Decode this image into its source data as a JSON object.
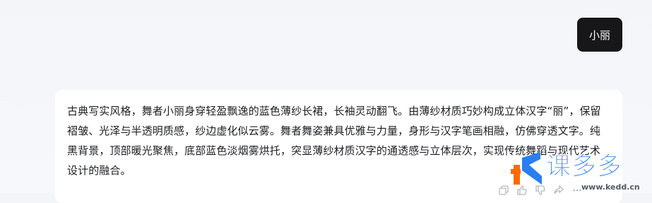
{
  "conversation": {
    "user_message": "小丽",
    "assistant_message": "古典写实风格，舞者小丽身穿轻盈飘逸的蓝色薄纱长裙，长袖灵动翻飞。由薄纱材质巧妙构成立体汉字“丽”，保留褶皱、光泽与半透明质感，纱边虚化似云雾。舞者舞姿兼具优雅与力量，身形与汉字笔画相融，仿佛穿透文字。纯黑背景，顶部暖光聚焦，底部蓝色淡烟雾烘托，突显薄纱材质汉字的通透感与立体层次，实现传统舞蹈与现代艺术设计的融合。"
  },
  "actions": {
    "icons": [
      "copy-icon",
      "thumbs-up-icon",
      "thumbs-down-icon",
      "share-icon",
      "more-icon"
    ]
  },
  "watermark": {
    "brand": "课多多",
    "url": "www.kedd.cn",
    "brand_color": "#2a7ef0",
    "logo_colors": [
      "#ff6a00",
      "#2a7ef0"
    ]
  },
  "colors": {
    "user_bubble_bg": "#17171a",
    "page_bg": "#f4f5f9",
    "card_bg": "#ffffff",
    "text": "#1e1f24"
  }
}
